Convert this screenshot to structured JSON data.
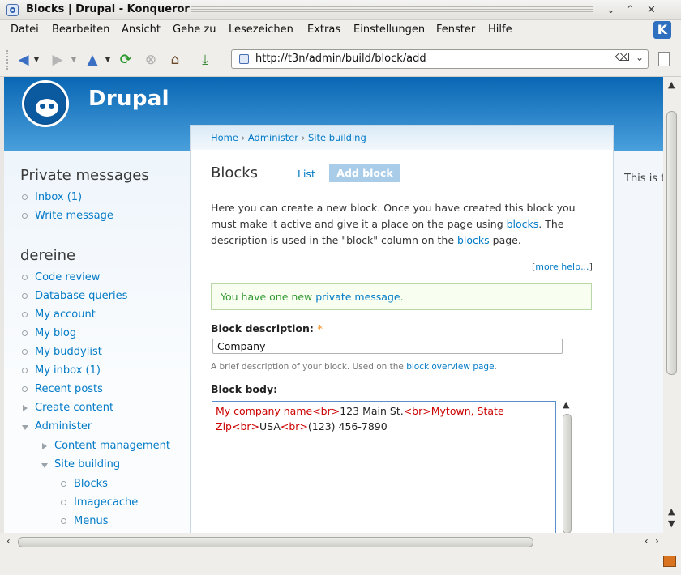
{
  "window": {
    "title": "Blocks | Drupal - Konqueror",
    "min_glyph": "⌄",
    "max_glyph": "⌃",
    "close_glyph": "✕"
  },
  "menubar": [
    "Datei",
    "Bearbeiten",
    "Ansicht",
    "Gehe zu",
    "Lesezeichen",
    "Extras",
    "Einstellungen",
    "Fenster",
    "Hilfe"
  ],
  "toolbar": {
    "url": "http://t3n/admin/build/block/add",
    "icons": [
      "back-icon",
      "forward-icon",
      "up-icon",
      "reload-icon",
      "stop-icon",
      "home-icon",
      "download-icon"
    ],
    "colors": {
      "back": "#3a6fc4",
      "reload": "#2d9a2d",
      "stop": "#b0b0b0"
    }
  },
  "site": {
    "name": "Drupal",
    "header_color": "#0a67b4"
  },
  "right_column_text": "This is t",
  "sidebar": {
    "private_title": "Private messages",
    "private_items": [
      "Inbox (1)",
      "Write message"
    ],
    "user_title": "dereine",
    "user_items": [
      "Code review",
      "Database queries",
      "My account",
      "My blog",
      "My buddylist",
      "My inbox (1)",
      "Recent posts",
      "Create content",
      "Administer"
    ],
    "admin_children": [
      "Content management",
      "Site building"
    ],
    "site_building_children": [
      "Blocks",
      "Imagecache",
      "Menus"
    ]
  },
  "breadcrumb": {
    "home": "Home",
    "administer": "Administer",
    "site_building": "Site building",
    "separator": "›"
  },
  "page": {
    "title": "Blocks",
    "tab_list": "List",
    "tab_add": "Add block",
    "intro_1": "Here you can create a new block. Once you have created this block you must make it active and give it a place on the page using ",
    "intro_link_1": "blocks",
    "intro_2": ". The description is used in the \"block\" column on the ",
    "intro_link_2": "blocks",
    "intro_3": " page.",
    "more_help": "more help...",
    "status_prefix": "You have one new ",
    "status_link": "private message",
    "status_suffix": ".",
    "desc_label": "Block description:",
    "required_mark": "*",
    "desc_value": "Company",
    "desc_help_prefix": "A brief description of your block. Used on the ",
    "desc_help_link": "block overview page",
    "desc_help_suffix": ".",
    "body_label": "Block body:",
    "body": {
      "t1": "My company name",
      "t2": "<br>",
      "t3": "123 Main St.",
      "t4": "<br>",
      "t5": "Mytown, State",
      "t6": "Zip",
      "t7": "<br>",
      "t8": "USA",
      "t9": "<br>",
      "t10": "(123) 456-7890"
    }
  }
}
